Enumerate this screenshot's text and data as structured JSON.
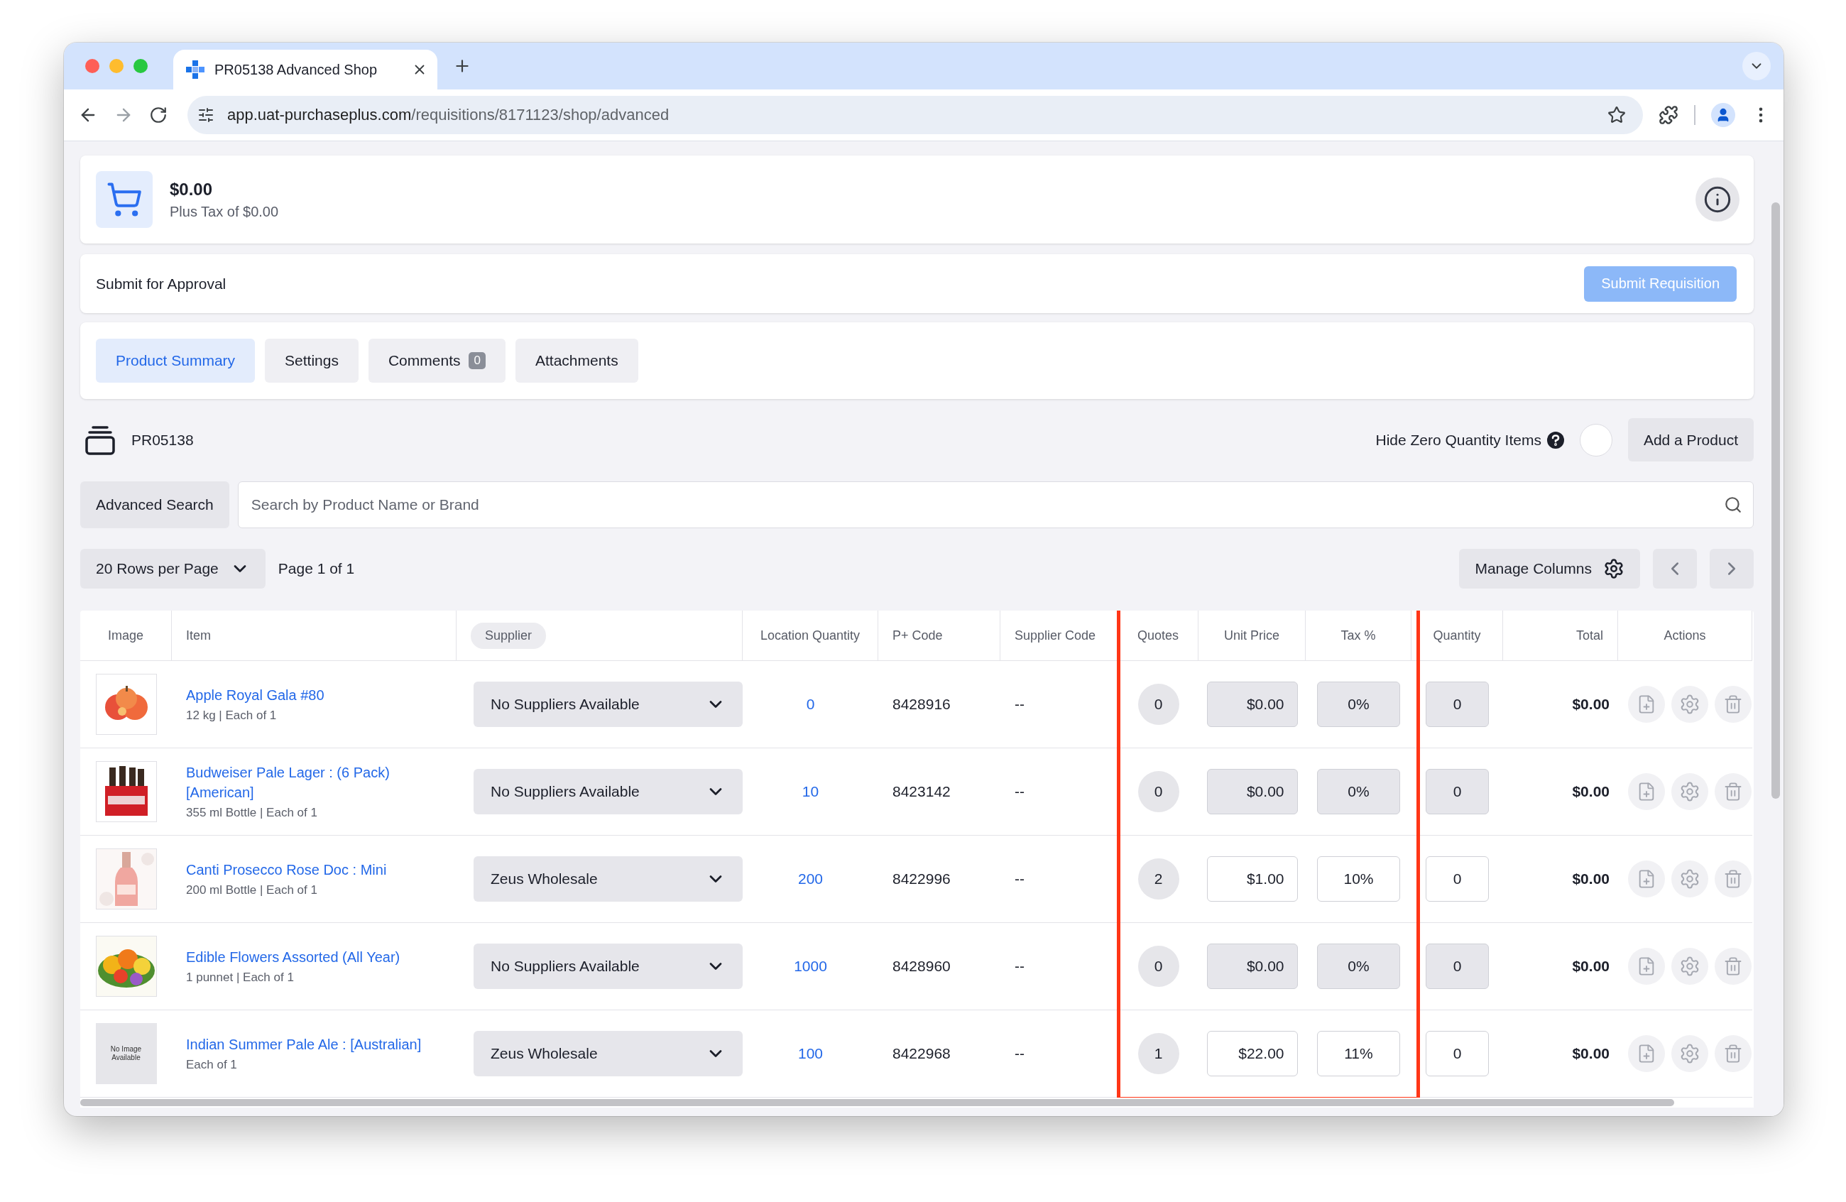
{
  "browser": {
    "tab_title": "PR05138 Advanced Shop",
    "url_host": "app.uat-purchaseplus.com",
    "url_path": "/requisitions/8171123/shop/advanced"
  },
  "summary": {
    "total": "$0.00",
    "tax": "Plus Tax of $0.00"
  },
  "approval": {
    "label": "Submit for Approval",
    "button": "Submit Requisition"
  },
  "tabs": [
    {
      "label": "Product Summary",
      "selected": true
    },
    {
      "label": "Settings",
      "selected": false
    },
    {
      "label": "Comments",
      "badge": "0",
      "selected": false
    },
    {
      "label": "Attachments",
      "selected": false
    }
  ],
  "requisition": {
    "number": "PR05138",
    "hide_zero_label": "Hide Zero Quantity Items",
    "hide_zero_on": false,
    "add_button": "Add a Product"
  },
  "search": {
    "advanced_button": "Advanced Search",
    "placeholder": "Search by Product Name or Brand"
  },
  "pagination": {
    "rows_per_page": "20 Rows per Page",
    "page": "Page 1 of 1",
    "manage_columns": "Manage Columns"
  },
  "table": {
    "columns": [
      {
        "label": "Image",
        "selected": false,
        "highlighted": false
      },
      {
        "label": "Item",
        "selected": false,
        "highlighted": false
      },
      {
        "label": "Supplier",
        "selected": true,
        "highlighted": false
      },
      {
        "label": "Location Quantity",
        "selected": false,
        "highlighted": false
      },
      {
        "label": "P+ Code",
        "selected": false,
        "highlighted": false
      },
      {
        "label": "Supplier Code",
        "selected": false,
        "highlighted": false
      },
      {
        "label": "Quotes",
        "selected": false,
        "highlighted": true
      },
      {
        "label": "Unit Price",
        "selected": false,
        "highlighted": true
      },
      {
        "label": "Tax %",
        "selected": false,
        "highlighted": true
      },
      {
        "label": "Quantity",
        "selected": false,
        "highlighted": false
      },
      {
        "label": "Total",
        "selected": false,
        "highlighted": false
      },
      {
        "label": "Actions",
        "selected": false,
        "highlighted": false
      }
    ],
    "rows": [
      {
        "name": "Apple Royal Gala #80",
        "detail": "12 kg | Each of 1",
        "supplier": "No Suppliers Available",
        "location_quantity": "0",
        "p_code": "8428916",
        "supplier_code": "--",
        "quotes": "0",
        "unit_price": "$0.00",
        "tax": "0%",
        "disabled": true,
        "quantity": "0",
        "total": "$0.00"
      },
      {
        "name": "Budweiser Pale Lager : (6 Pack) [American]",
        "detail": "355 ml Bottle | Each of 1",
        "supplier": "No Suppliers Available",
        "location_quantity": "10",
        "p_code": "8423142",
        "supplier_code": "--",
        "quotes": "0",
        "unit_price": "$0.00",
        "tax": "0%",
        "disabled": true,
        "quantity": "0",
        "total": "$0.00"
      },
      {
        "name": "Canti Prosecco Rose Doc : Mini",
        "detail": "200 ml Bottle | Each of 1",
        "supplier": "Zeus Wholesale",
        "location_quantity": "200",
        "p_code": "8422996",
        "supplier_code": "--",
        "quotes": "2",
        "unit_price": "$1.00",
        "tax": "10%",
        "disabled": false,
        "quantity": "0",
        "total": "$0.00"
      },
      {
        "name": "Edible Flowers Assorted (All Year)",
        "detail": "1 punnet | Each of 1",
        "supplier": "No Suppliers Available",
        "location_quantity": "1000",
        "p_code": "8428960",
        "supplier_code": "--",
        "quotes": "0",
        "unit_price": "$0.00",
        "tax": "0%",
        "disabled": true,
        "quantity": "0",
        "total": "$0.00"
      },
      {
        "image": {
          "kind": "placeholder",
          "text": "No Image Available"
        },
        "name": "Indian Summer Pale Ale : [Australian]",
        "detail": "Each of 1",
        "supplier": "Zeus Wholesale",
        "location_quantity": "100",
        "p_code": "8422968",
        "supplier_code": "--",
        "quotes": "1",
        "unit_price": "$22.00",
        "tax": "11%",
        "disabled": false,
        "quantity": "0",
        "total": "$0.00"
      }
    ]
  }
}
